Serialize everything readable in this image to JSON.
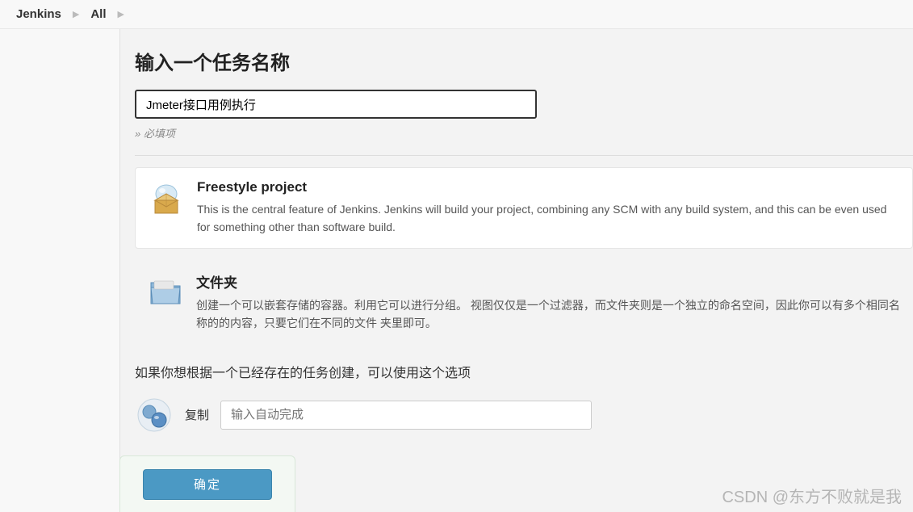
{
  "breadcrumb": {
    "root": "Jenkins",
    "view": "All"
  },
  "header": {
    "title": "输入一个任务名称"
  },
  "form": {
    "name_value": "Jmeter接口用例执行",
    "required": "» 必填项"
  },
  "items": [
    {
      "title": "Freestyle project",
      "desc": "This is the central feature of Jenkins. Jenkins will build your project, combining any SCM with any build system, and this can be even used for something other than software build."
    },
    {
      "title": "文件夹",
      "desc": "创建一个可以嵌套存储的容器。利用它可以进行分组。 视图仅仅是一个过滤器，而文件夹则是一个独立的命名空间，因此你可以有多个相同名称的的内容，只要它们在不同的文件 夹里即可。"
    }
  ],
  "copy": {
    "intro": "如果你想根据一个已经存在的任务创建，可以使用这个选项",
    "label": "复制",
    "placeholder": "输入自动完成"
  },
  "footer": {
    "ok": "确定"
  },
  "watermark": "CSDN @东方不败就是我"
}
